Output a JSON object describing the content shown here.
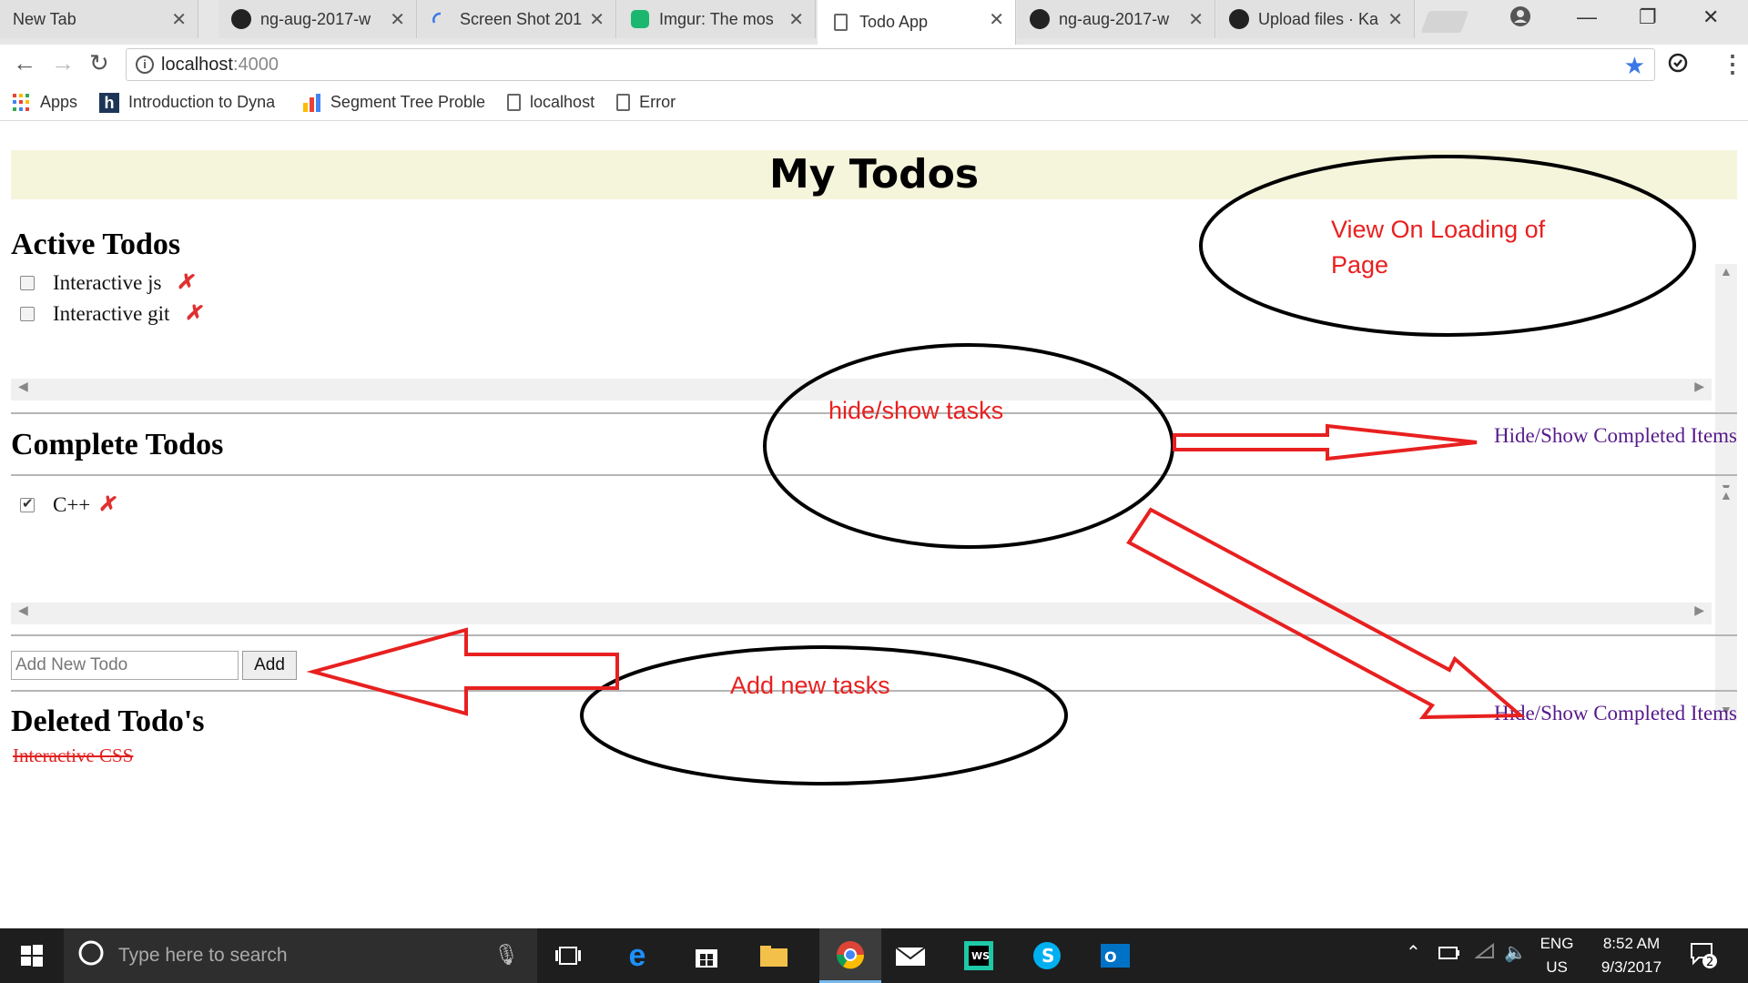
{
  "browser": {
    "tabs": [
      {
        "label": "New Tab",
        "icon": "none"
      },
      {
        "label": "ng-aug-2017-w",
        "icon": "github-icon"
      },
      {
        "label": "Screen Shot 201",
        "icon": "screenshot-icon"
      },
      {
        "label": "Imgur: The mos",
        "icon": "imgur-icon"
      },
      {
        "label": "Todo App",
        "icon": "document-icon"
      },
      {
        "label": "ng-aug-2017-w",
        "icon": "github-icon"
      },
      {
        "label": "Upload files · Ka",
        "icon": "github-icon"
      }
    ],
    "active_tab": 4,
    "url_host": "localhost",
    "url_port": ":4000",
    "bookmarks": [
      {
        "label": "Apps",
        "icon": "apps-grid-icon"
      },
      {
        "label": "Introduction to Dyna",
        "icon": "h-icon"
      },
      {
        "label": "Segment Tree Proble",
        "icon": "bar-chart-icon"
      },
      {
        "label": "localhost",
        "icon": "document-icon"
      },
      {
        "label": "Error",
        "icon": "document-icon"
      }
    ]
  },
  "app": {
    "title": "My Todos",
    "active_heading": "Active Todos",
    "active_todos": [
      {
        "text": "Interactive js",
        "done": false
      },
      {
        "text": "Interactive git",
        "done": false
      }
    ],
    "complete_heading": "Complete Todos",
    "complete_todos": [
      {
        "text": "C++",
        "done": true
      }
    ],
    "toggle_link": "Hide/Show Completed Items",
    "add_placeholder": "Add New Todo",
    "add_button": "Add",
    "deleted_heading": "Deleted Todo's",
    "deleted_todos": [
      "Interactive CSS"
    ]
  },
  "annotations": {
    "view_on_load": "View On Loading of Page",
    "hide_show": "hide/show tasks",
    "add_new": "Add new tasks",
    "color": "#e82020"
  },
  "taskbar": {
    "search_placeholder": "Type here to search",
    "language": "ENG",
    "region": "US",
    "time": "8:52 AM",
    "date": "9/3/2017",
    "notification_count": "2"
  }
}
